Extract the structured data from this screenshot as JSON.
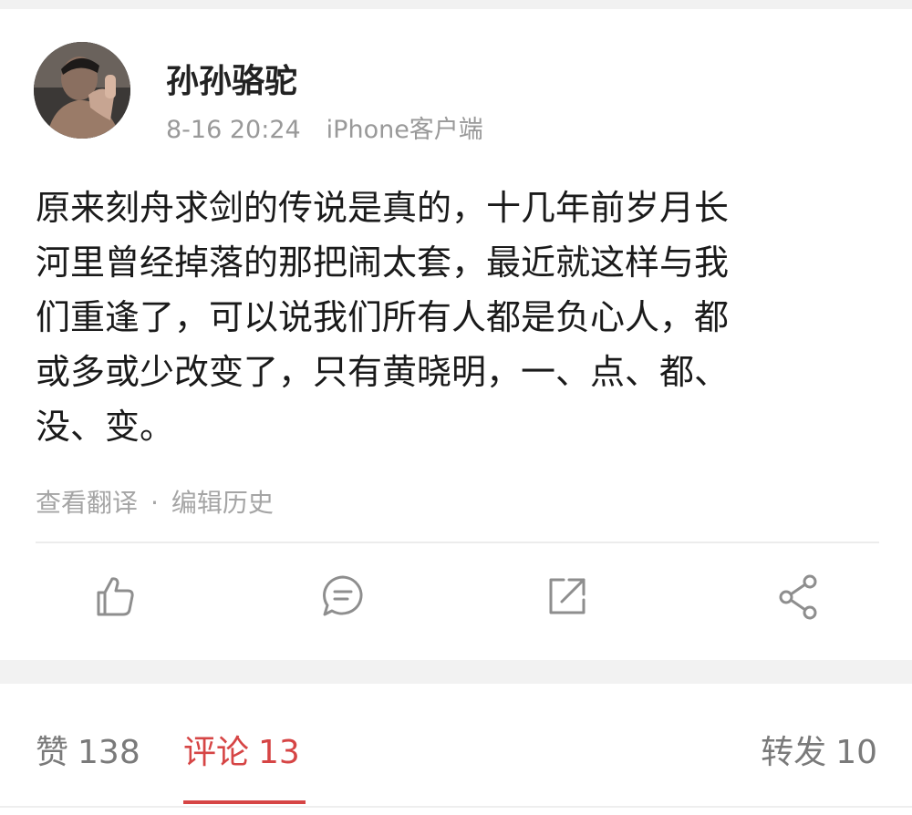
{
  "post": {
    "author": {
      "name": "孙孙骆驼",
      "timestamp": "8-16 20:24",
      "client": "iPhone客户端"
    },
    "content_lines": [
      "原来刻舟求剑的传说是真的，十几年前岁月长",
      "河里曾经掉落的那把闹太套，最近就这样与我",
      "们重逢了，可以说我们所有人都是负心人，都",
      "或多或少改变了，只有黄晓明，一、点、都、",
      "没、变。"
    ],
    "links": {
      "translate": "查看翻译",
      "separator": "·",
      "edit_history": "编辑历史"
    },
    "actions": [
      "thumbs-up-icon",
      "comment-icon",
      "repost-icon",
      "share-icon"
    ]
  },
  "tabs": {
    "likes": {
      "label": "赞",
      "count": "138"
    },
    "comments": {
      "label": "评论",
      "count": "13",
      "active": true
    },
    "reposts": {
      "label": "转发",
      "count": "10"
    }
  },
  "colors": {
    "accent": "#d64545",
    "text": "#1a1a1a",
    "muted": "#999999",
    "icon": "#8e8e8e",
    "band": "#f2f2f2"
  }
}
